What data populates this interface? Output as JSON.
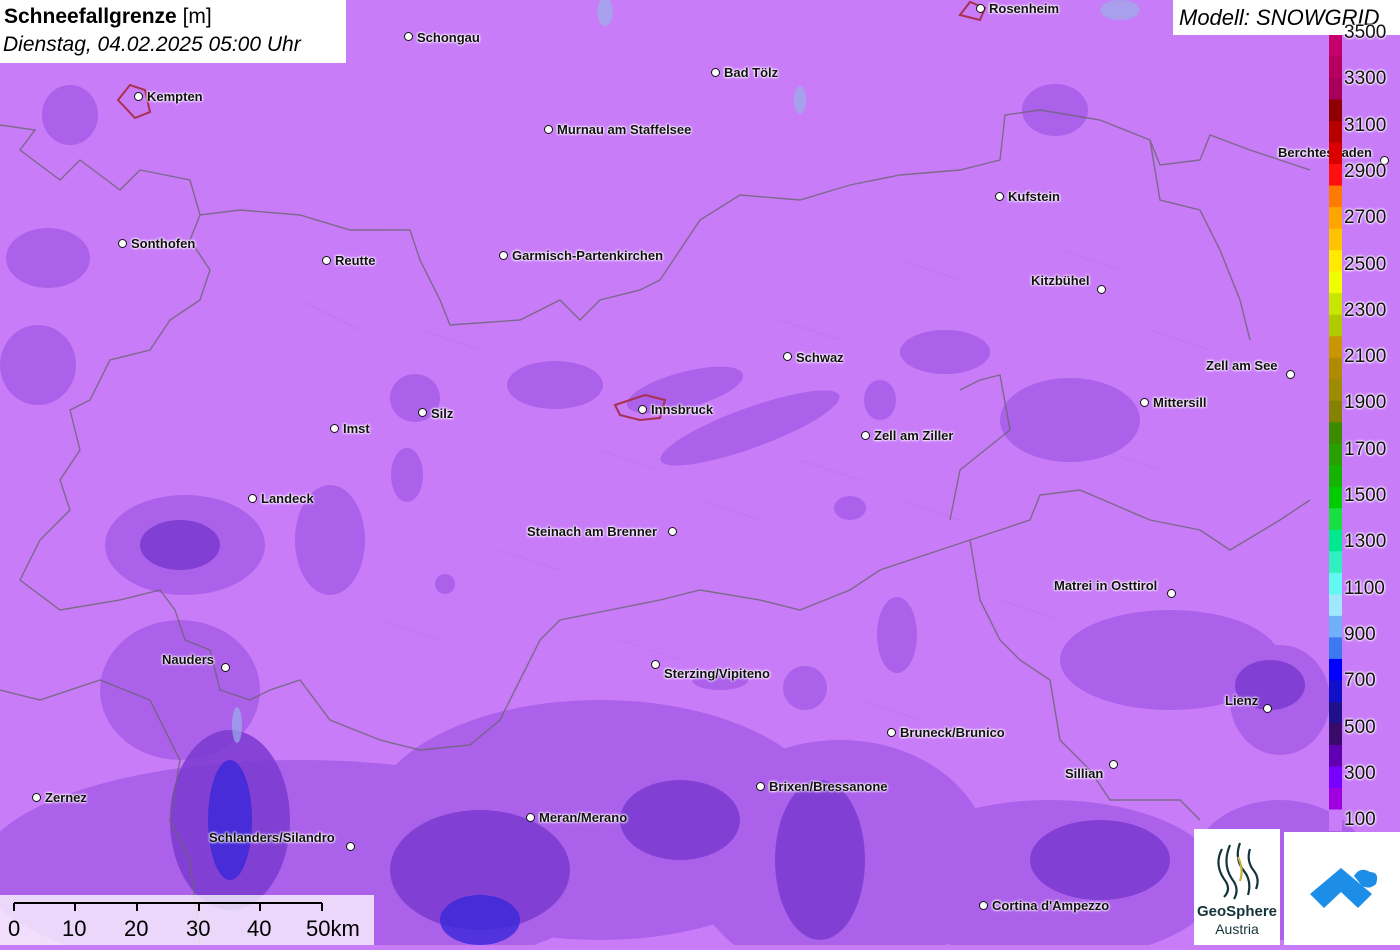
{
  "title": {
    "main": "Schneefallgrenze",
    "unit": "[m]",
    "date": "Dienstag, 04.02.2025 05:00 Uhr"
  },
  "model": {
    "label": "Modell: SNOWGRID"
  },
  "legend": {
    "labels": [
      "3500",
      "3300",
      "3100",
      "2900",
      "2700",
      "2500",
      "2300",
      "2100",
      "1900",
      "1700",
      "1500",
      "1300",
      "1100",
      "900",
      "700",
      "500",
      "300",
      "100"
    ],
    "colors": [
      "#c4006c",
      "#b60060",
      "#a8005a",
      "#8e0000",
      "#b60000",
      "#da0000",
      "#ff1010",
      "#ff7a00",
      "#ffa500",
      "#ffc400",
      "#ffea00",
      "#f0ff00",
      "#c8e600",
      "#b0cc00",
      "#c89600",
      "#b08a00",
      "#9c8c00",
      "#848200",
      "#3c8c00",
      "#2aa000",
      "#14b400",
      "#00cc00",
      "#18e040",
      "#00e890",
      "#30f0c0",
      "#60f8f0",
      "#a0e8ff",
      "#70b0f8",
      "#3c78f0",
      "#0000ff",
      "#1010c8",
      "#20108c",
      "#3a0a6a",
      "#6000b0",
      "#7800ff",
      "#a000e0",
      "#c87cf8"
    ]
  },
  "scale": {
    "labels": [
      "0",
      "10",
      "20",
      "30",
      "40",
      "50km"
    ]
  },
  "logos": {
    "geosphere_name": "GeoSphere",
    "geosphere_sub": "Austria"
  },
  "cities": [
    {
      "name": "Rosenheim"
    },
    {
      "name": "Schongau"
    },
    {
      "name": "Bad Tölz"
    },
    {
      "name": "Kempten"
    },
    {
      "name": "Murnau am Staffelsee"
    },
    {
      "name": "Berchtesgaden"
    },
    {
      "name": "Kufstein"
    },
    {
      "name": "Sonthofen"
    },
    {
      "name": "Reutte"
    },
    {
      "name": "Garmisch-Partenkirchen"
    },
    {
      "name": "Kitzbühel"
    },
    {
      "name": "Schwaz"
    },
    {
      "name": "Zell am See"
    },
    {
      "name": "Innsbruck"
    },
    {
      "name": "Mittersill"
    },
    {
      "name": "Silz"
    },
    {
      "name": "Imst"
    },
    {
      "name": "Zell am Ziller"
    },
    {
      "name": "Landeck"
    },
    {
      "name": "Steinach am Brenner"
    },
    {
      "name": "Matrei in Osttirol"
    },
    {
      "name": "Nauders"
    },
    {
      "name": "Sterzing/Vipiteno"
    },
    {
      "name": "Lienz"
    },
    {
      "name": "Bruneck/Brunico"
    },
    {
      "name": "Sillian"
    },
    {
      "name": "Brixen/Bressanone"
    },
    {
      "name": "Zernez"
    },
    {
      "name": "Meran/Merano"
    },
    {
      "name": "Schlanders/Silandro"
    },
    {
      "name": "Cortina d'Ampezzo"
    }
  ]
}
